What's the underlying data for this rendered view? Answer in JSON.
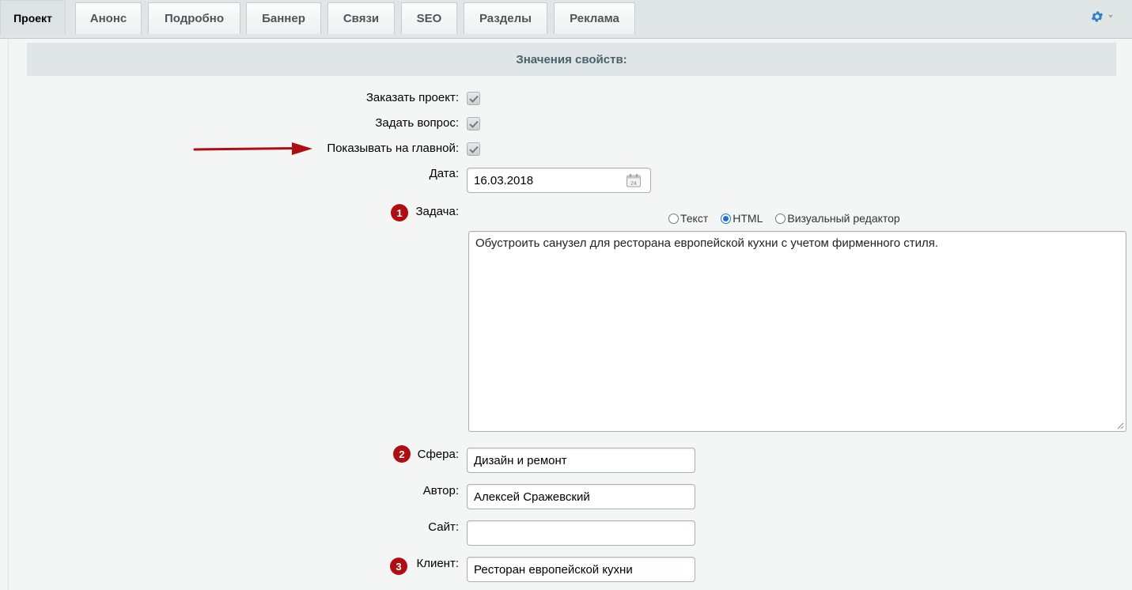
{
  "tabs": [
    {
      "label": "Проект",
      "active": true
    },
    {
      "label": "Анонс"
    },
    {
      "label": "Подробно"
    },
    {
      "label": "Баннер"
    },
    {
      "label": "Связи"
    },
    {
      "label": "SEO"
    },
    {
      "label": "Разделы"
    },
    {
      "label": "Реклама"
    }
  ],
  "settings_icon": "gear-icon",
  "section_title": "Значения свойств:",
  "fields": {
    "order_project": {
      "label": "Заказать проект:",
      "checked": true
    },
    "ask_question": {
      "label": "Задать вопрос:",
      "checked": true
    },
    "show_on_main": {
      "label": "Показывать на главной:",
      "checked": true
    },
    "date": {
      "label": "Дата:",
      "value": "16.03.2018",
      "icon": "calendar-icon"
    },
    "task": {
      "label": "Задача:",
      "badge": "1",
      "modes": [
        "Текст",
        "HTML",
        "Визуальный редактор"
      ],
      "selected_mode": "HTML",
      "value": "Обустроить санузел для ресторана европейской кухни с учетом фирменного стиля."
    },
    "sphere": {
      "label": "Сфера:",
      "badge": "2",
      "value": "Дизайн и ремонт"
    },
    "author": {
      "label": "Автор:",
      "value": "Алексей Сражевский"
    },
    "site": {
      "label": "Сайт:",
      "value": ""
    },
    "client": {
      "label": "Клиент:",
      "badge": "3",
      "value": "Ресторан европейской кухни"
    }
  },
  "colors": {
    "accent_red": "#b00d12",
    "radio_blue": "#1f6fd1",
    "gear_blue": "#2f7fcf"
  }
}
